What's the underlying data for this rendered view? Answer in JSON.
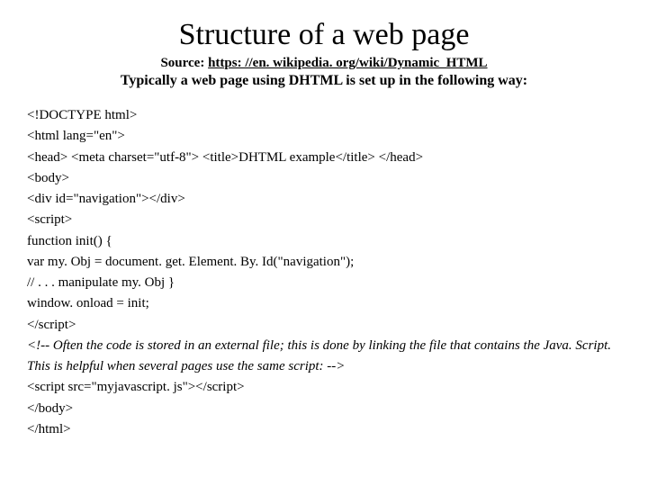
{
  "title": "Structure of a web page",
  "source_label": "Source: ",
  "source_url": "https: //en. wikipedia. org/wiki/Dynamic_HTML",
  "intro": "Typically a web page using DHTML is set up in the following way:",
  "code": {
    "l1": "<!DOCTYPE html>",
    "l2": "<html lang=\"en\">",
    "l3": "<head> <meta charset=\"utf-8\"> <title>DHTML example</title> </head>",
    "l4": "<body>",
    "l5": "<div id=\"navigation\"></div>",
    "l6": "<script>",
    "l7": "function init() {",
    "l8": "var my. Obj = document. get. Element. By. Id(\"navigation\");",
    "l9": "// . . . manipulate my. Obj }",
    "l10": "window. onload = init;",
    "l11_close": "script>",
    "l12": "<!-- Often the code is stored in an external file; this is done by linking the file that contains the Java. Script. This is helpful when several pages use the same script: -->",
    "l13_open": "<script src=\"myjavascript. js\"></",
    "l13_close": "script>",
    "l14": "</body>",
    "l15": "</html>"
  }
}
